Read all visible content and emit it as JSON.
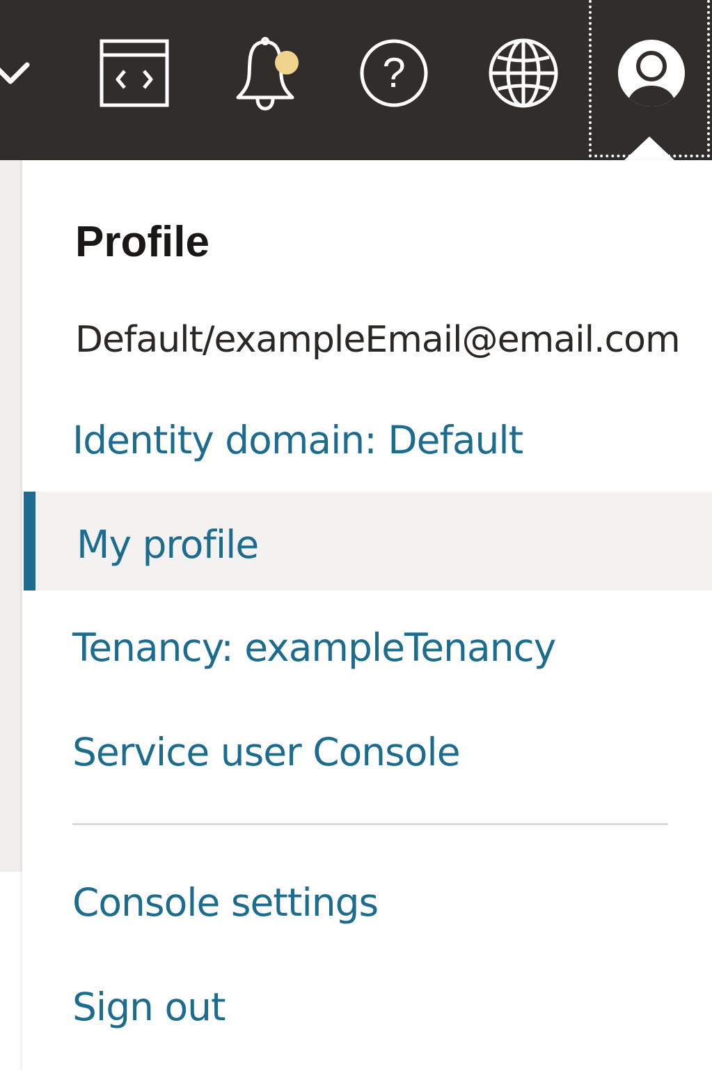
{
  "topbar": {
    "icons": {
      "chevron": "chevron-down-icon",
      "code": "code-editor-icon",
      "bell": "bell-icon",
      "help": "help-icon",
      "globe": "globe-icon",
      "profile": "user-avatar-icon"
    },
    "help_glyph": "?",
    "notification_dot_color": "#f0d48e",
    "background_color": "#312d2a"
  },
  "profile_menu": {
    "heading": "Profile",
    "user_email": "Default/exampleEmail@email.com",
    "identity_domain": "Identity domain: Default",
    "my_profile": "My profile",
    "tenancy": "Tenancy: exampleTenancy",
    "service_user_console": "Service user Console",
    "console_settings": "Console settings",
    "sign_out": "Sign out",
    "link_color": "#1b6c8f"
  }
}
